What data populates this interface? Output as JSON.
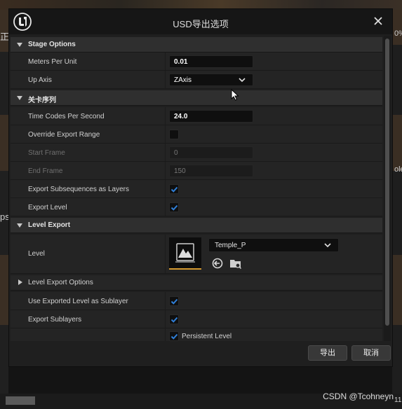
{
  "dialog": {
    "title": "USD导出选项",
    "export_button": "导出",
    "cancel_button": "取消"
  },
  "sections": {
    "stage_options": "Stage Options",
    "level_sequence": "关卡序列",
    "level_export": "Level Export",
    "level_export_options": "Level Export Options"
  },
  "stage_options": {
    "meters_per_unit": {
      "label": "Meters Per Unit",
      "value": "0.01"
    },
    "up_axis": {
      "label": "Up Axis",
      "value": "ZAxis"
    }
  },
  "level_sequence": {
    "time_codes_per_second": {
      "label": "Time Codes Per Second",
      "value": "24.0"
    },
    "override_export_range": {
      "label": "Override Export Range",
      "checked": false
    },
    "start_frame": {
      "label": "Start Frame",
      "value": "0"
    },
    "end_frame": {
      "label": "End Frame",
      "value": "150"
    },
    "export_subsequences": {
      "label": "Export Subsequences as Layers",
      "checked": true
    },
    "export_level": {
      "label": "Export Level",
      "checked": true
    }
  },
  "level_export": {
    "level": {
      "label": "Level",
      "asset": "Temple_P"
    },
    "use_exported_level_as_sublayer": {
      "label": "Use Exported Level as Sublayer",
      "checked": true
    },
    "export_sublayers": {
      "label": "Export Sublayers",
      "checked": true
    },
    "persistent_level": {
      "label": "Persistent Level",
      "checked": true
    }
  },
  "background": {
    "left_fragment_1": "正",
    "left_fragment_2": "ps",
    "right_fragment_1": "0%",
    "right_fragment_2": "ole",
    "right_fragment_3": "11"
  },
  "watermark": "CSDN @Tcohneyn",
  "colors": {
    "accent_check": "#2f7fd8",
    "thumbnail_underline": "#d49a30",
    "panel_bg": "#242424",
    "section_bg": "#2f2f2f"
  }
}
